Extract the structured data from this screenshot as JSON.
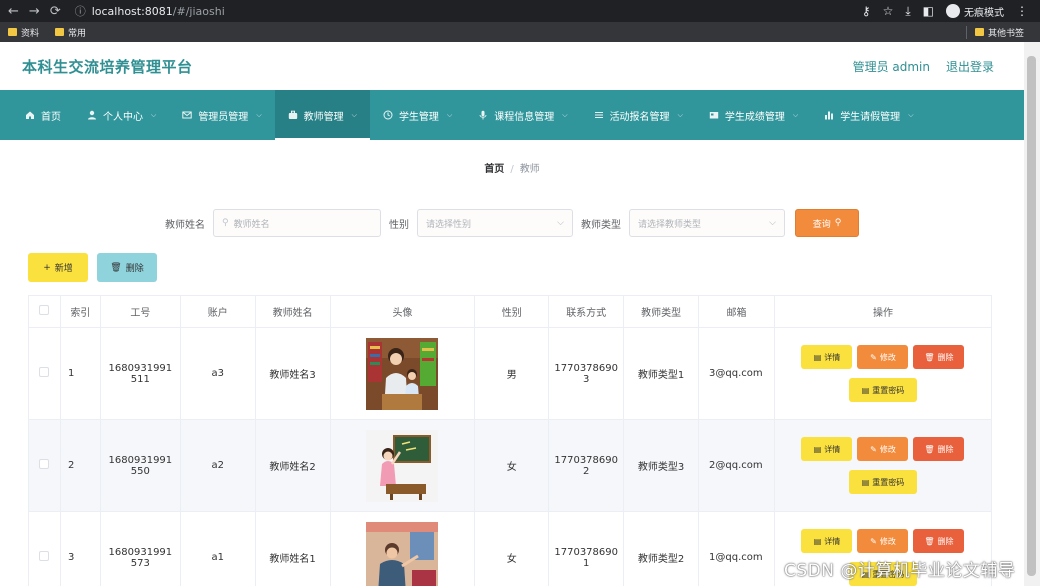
{
  "browser": {
    "url_host": "localhost:8081",
    "url_path": "/#/jiaoshi",
    "incognito_label": "无痕模式",
    "bookmarks": [
      "资料",
      "常用"
    ],
    "other_bookmarks": "其他书签"
  },
  "header": {
    "title": "本科生交流培养管理平台",
    "user_label": "管理员 admin",
    "logout_label": "退出登录"
  },
  "menu": [
    {
      "label": "首页",
      "icon": "home-icon"
    },
    {
      "label": "个人中心",
      "icon": "user-icon"
    },
    {
      "label": "管理员管理",
      "icon": "mail-icon"
    },
    {
      "label": "教师管理",
      "icon": "briefcase-icon"
    },
    {
      "label": "学生管理",
      "icon": "clock-icon"
    },
    {
      "label": "课程信息管理",
      "icon": "mic-icon"
    },
    {
      "label": "活动报名管理",
      "icon": "list-icon"
    },
    {
      "label": "学生成绩管理",
      "icon": "card-icon"
    },
    {
      "label": "学生请假管理",
      "icon": "bar-chart-icon"
    }
  ],
  "breadcrumb": {
    "home": "首页",
    "sep": "/",
    "current": "教师"
  },
  "search": {
    "name_label": "教师姓名",
    "name_placeholder": "教师姓名",
    "gender_label": "性别",
    "gender_placeholder": "请选择性别",
    "type_label": "教师类型",
    "type_placeholder": "请选择教师类型",
    "search_button": "查询"
  },
  "actions": {
    "add": "新增",
    "delete": "删除"
  },
  "table": {
    "headers": [
      "索引",
      "工号",
      "账户",
      "教师姓名",
      "头像",
      "性别",
      "联系方式",
      "教师类型",
      "邮箱",
      "操作"
    ],
    "rows": [
      {
        "index": "1",
        "id_line1": "1680931991",
        "id_line2": "511",
        "account": "a3",
        "name": "教师姓名3",
        "gender": "男",
        "phone_line1": "1770378690",
        "phone_line2": "3",
        "type": "教师类型1",
        "email": "3@qq.com"
      },
      {
        "index": "2",
        "id_line1": "1680931991",
        "id_line2": "550",
        "account": "a2",
        "name": "教师姓名2",
        "gender": "女",
        "phone_line1": "1770378690",
        "phone_line2": "2",
        "type": "教师类型3",
        "email": "2@qq.com"
      },
      {
        "index": "3",
        "id_line1": "1680931991",
        "id_line2": "573",
        "account": "a1",
        "name": "教师姓名1",
        "gender": "女",
        "phone_line1": "1770378690",
        "phone_line2": "1",
        "type": "教师类型2",
        "email": "1@qq.com"
      }
    ],
    "ops": {
      "detail": "详情",
      "edit": "修改",
      "remove": "删除",
      "reset": "重置密码"
    }
  },
  "watermark": "CSDN @计算机毕业论文辅导"
}
